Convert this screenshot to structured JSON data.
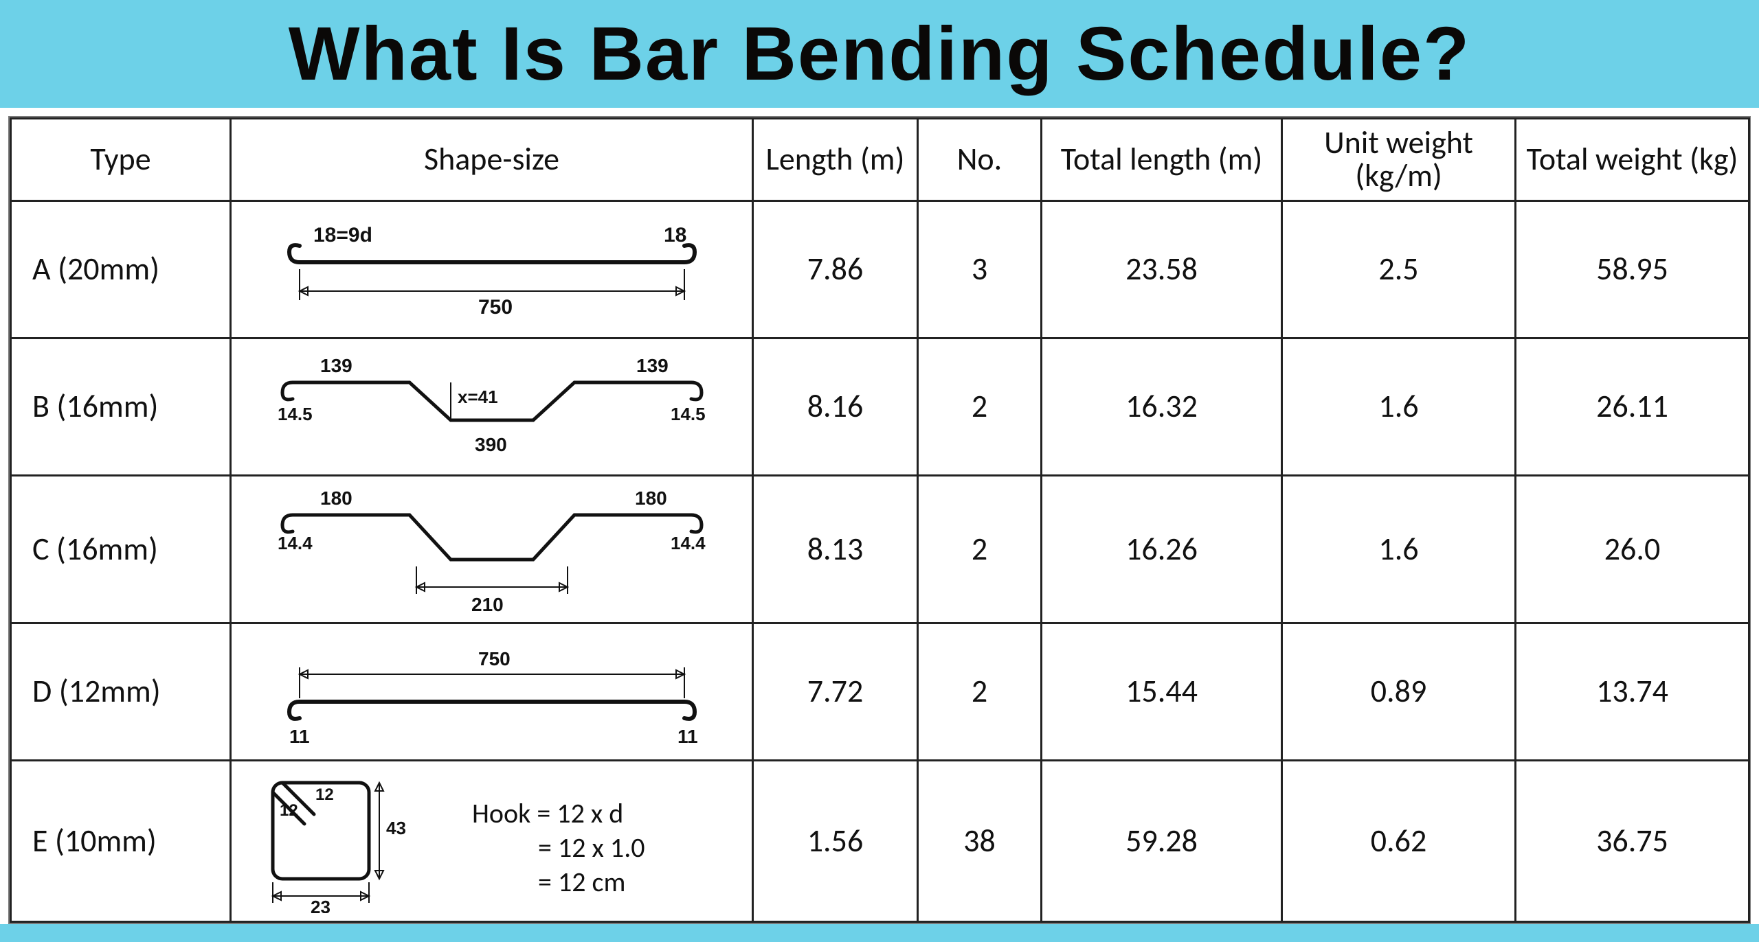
{
  "title": "What Is Bar Bending Schedule?",
  "headers": {
    "type": "Type",
    "shape": "Shape-size",
    "length": "Length (m)",
    "no": "No.",
    "total_length": "Total length (m)",
    "unit_weight": "Unit weight (kg/m)",
    "total_weight": "Total weight (kg)"
  },
  "rows": [
    {
      "type": "A (20mm)",
      "length": "7.86",
      "no": "3",
      "total_length": "23.58",
      "unit_weight": "2.5",
      "total_weight": "58.95",
      "shape": {
        "hook_l": "18=9d",
        "hook_r": "18",
        "span": "750"
      }
    },
    {
      "type": "B (16mm)",
      "length": "8.16",
      "no": "2",
      "total_length": "16.32",
      "unit_weight": "1.6",
      "total_weight": "26.11",
      "shape": {
        "top_l": "139",
        "top_r": "139",
        "hook_l": "14.5",
        "hook_r": "14.5",
        "mid": "x=41",
        "bottom": "390"
      }
    },
    {
      "type": "C (16mm)",
      "length": "8.13",
      "no": "2",
      "total_length": "16.26",
      "unit_weight": "1.6",
      "total_weight": "26.0",
      "shape": {
        "top_l": "180",
        "top_r": "180",
        "hook_l": "14.4",
        "hook_r": "14.4",
        "bottom": "210"
      }
    },
    {
      "type": "D (12mm)",
      "length": "7.72",
      "no": "2",
      "total_length": "15.44",
      "unit_weight": "0.89",
      "total_weight": "13.74",
      "shape": {
        "span": "750",
        "hook_l": "11",
        "hook_r": "11"
      }
    },
    {
      "type": "E (10mm)",
      "length": "1.56",
      "no": "38",
      "total_length": "59.28",
      "unit_weight": "0.62",
      "total_weight": "36.75",
      "shape": {
        "tail1": "12",
        "tail2": "12",
        "height": "43",
        "width": "23"
      },
      "hook_note": [
        "Hook = 12 x d",
        "= 12 x 1.0",
        "= 12 cm"
      ]
    }
  ],
  "chart_data": {
    "type": "table",
    "title": "Bar Bending Schedule",
    "columns": [
      "Type",
      "Length (m)",
      "No.",
      "Total length (m)",
      "Unit weight (kg/m)",
      "Total weight (kg)"
    ],
    "rows": [
      [
        "A (20mm)",
        7.86,
        3,
        23.58,
        2.5,
        58.95
      ],
      [
        "B (16mm)",
        8.16,
        2,
        16.32,
        1.6,
        26.11
      ],
      [
        "C (16mm)",
        8.13,
        2,
        16.26,
        1.6,
        26.0
      ],
      [
        "D (12mm)",
        7.72,
        2,
        15.44,
        0.89,
        13.74
      ],
      [
        "E (10mm)",
        1.56,
        38,
        59.28,
        0.62,
        36.75
      ]
    ]
  }
}
